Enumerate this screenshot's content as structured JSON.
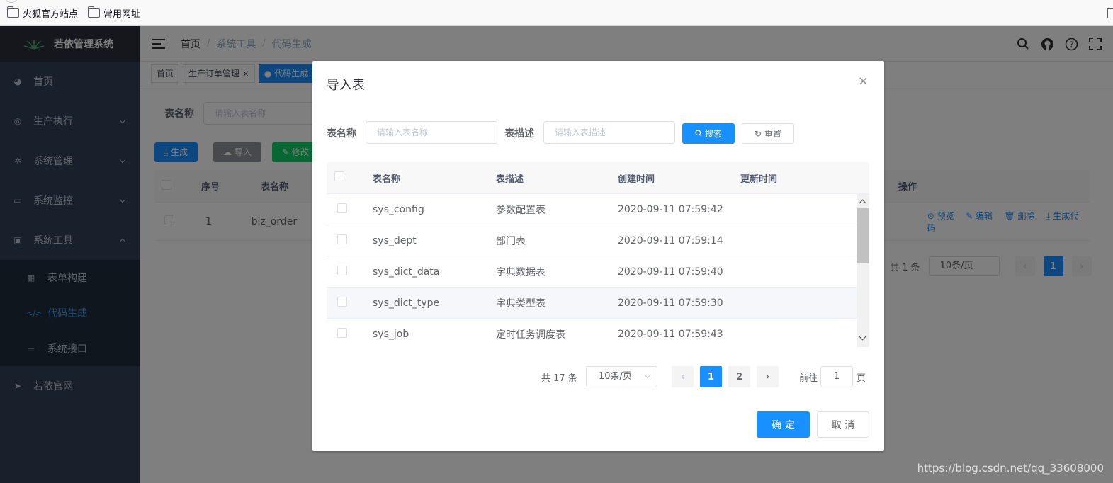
{
  "browser": {
    "bookmarks": [
      "火狐官方站点",
      "常用网址"
    ]
  },
  "app": {
    "logo_text": "若依管理系统"
  },
  "sidebar": {
    "items": [
      {
        "label": "首页",
        "icon": "dashboard-icon"
      },
      {
        "label": "生产执行",
        "icon": "production-icon"
      },
      {
        "label": "系统管理",
        "icon": "settings-icon"
      },
      {
        "label": "系统监控",
        "icon": "monitor-icon"
      },
      {
        "label": "系统工具",
        "icon": "toolbox-icon"
      }
    ],
    "subitems": [
      {
        "label": "表单构建",
        "icon": "form-icon"
      },
      {
        "label": "代码生成",
        "icon": "code-icon"
      },
      {
        "label": "系统接口",
        "icon": "api-icon"
      }
    ],
    "extra": {
      "label": "若依官网",
      "icon": "send-icon"
    }
  },
  "navbar": {
    "breadcrumb": [
      "首页",
      "系统工具",
      "代码生成"
    ]
  },
  "tags": [
    "首页",
    "生产订单管理",
    "代码生成"
  ],
  "background": {
    "query_label": "表名称",
    "query_placeholder": "请输入表名称",
    "buttons": {
      "generate": "生成",
      "import": "导入",
      "edit": "修改"
    },
    "columns": {
      "index": "序号",
      "name": "表名称",
      "ops": "操作"
    },
    "row": {
      "index": "1",
      "name": "biz_order"
    },
    "ops": [
      "预览",
      "编辑",
      "删除",
      "生成代码"
    ],
    "pager": {
      "total": "共 1 条",
      "sizes": "10条/页",
      "page": "1"
    }
  },
  "dialog": {
    "title": "导入表",
    "close": "×",
    "form": {
      "name_label": "表名称",
      "name_placeholder": "请输入表名称",
      "desc_label": "表描述",
      "desc_placeholder": "请输入表描述",
      "search": "搜索",
      "reset": "重置"
    },
    "columns": [
      "表名称",
      "表描述",
      "创建时间",
      "更新时间"
    ],
    "rows": [
      {
        "name": "sys_config",
        "desc": "参数配置表",
        "created": "2020-09-11 07:59:42",
        "updated": ""
      },
      {
        "name": "sys_dept",
        "desc": "部门表",
        "created": "2020-09-11 07:59:14",
        "updated": ""
      },
      {
        "name": "sys_dict_data",
        "desc": "字典数据表",
        "created": "2020-09-11 07:59:40",
        "updated": ""
      },
      {
        "name": "sys_dict_type",
        "desc": "字典类型表",
        "created": "2020-09-11 07:59:30",
        "updated": ""
      },
      {
        "name": "sys_job",
        "desc": "定时任务调度表",
        "created": "2020-09-11 07:59:43",
        "updated": ""
      }
    ],
    "pager": {
      "total": "共 17 条",
      "sizes": "10条/页",
      "pages": [
        "1",
        "2"
      ],
      "goto_prefix": "前往",
      "goto_value": "1",
      "goto_suffix": "页"
    },
    "confirm": "确 定",
    "cancel": "取 消"
  },
  "watermark": "https://blog.csdn.net/qq_33608000",
  "colors": {
    "primary": "#1890ff",
    "sidebar": "#304156",
    "submenu": "#1f2d3d"
  }
}
